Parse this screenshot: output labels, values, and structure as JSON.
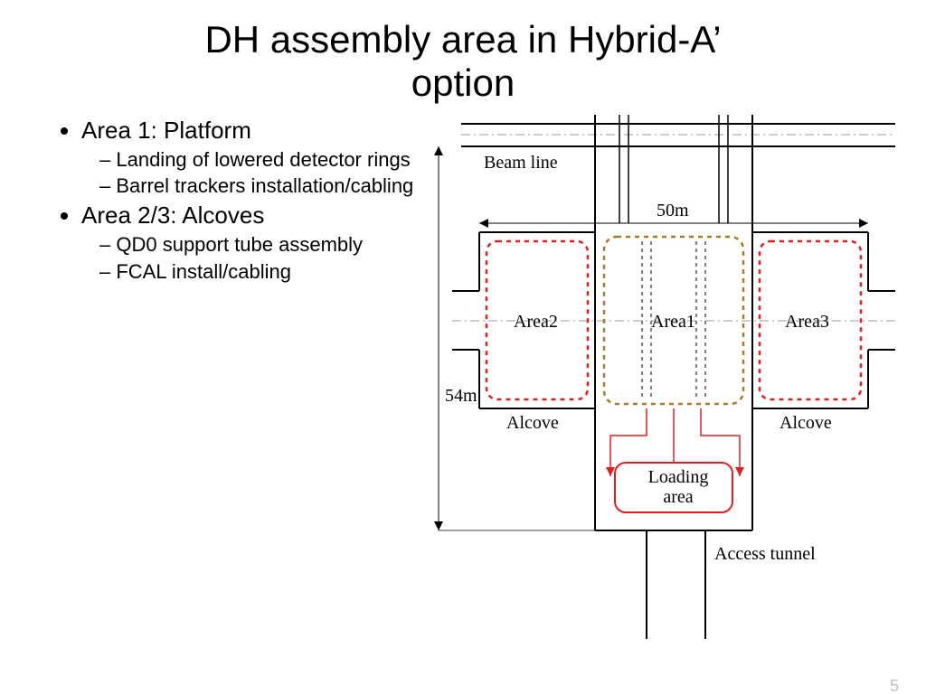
{
  "title_line1": "DH assembly area in Hybrid-A’",
  "title_line2": "option",
  "bullets": {
    "area1_title": "Area 1: Platform",
    "area1_sub1": "Landing of lowered detector rings",
    "area1_sub2": "Barrel trackers installation/cabling",
    "area23_title": "Area 2/3: Alcoves",
    "area23_sub1": "QD0 support tube assembly",
    "area23_sub2": "FCAL install/cabling"
  },
  "diagram": {
    "beam_line": "Beam line",
    "width_dim": "50m",
    "height_dim": "54m",
    "area1": "Area1",
    "area2": "Area2",
    "area3": "Area3",
    "alcove_left": "Alcove",
    "alcove_right": "Alcove",
    "loading_area": "Loading area",
    "access_tunnel": "Access tunnel"
  },
  "page_number": "5"
}
